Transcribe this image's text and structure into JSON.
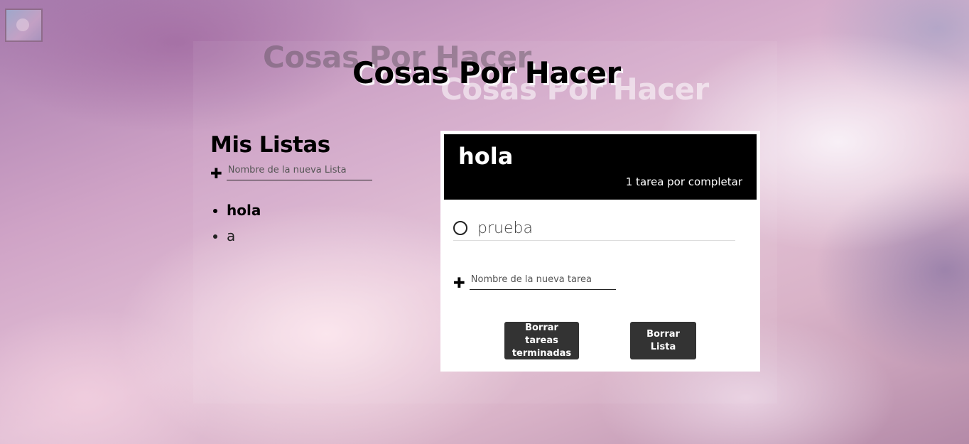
{
  "app": {
    "title": "Cosas Por Hacer"
  },
  "sidebar": {
    "heading": "Mis Listas",
    "add_icon": "plus-icon",
    "new_list_placeholder": "Nombre de la nueva Lista",
    "items": [
      {
        "label": "hola",
        "active": true
      },
      {
        "label": "a",
        "active": false
      }
    ]
  },
  "todo": {
    "list_title": "hola",
    "remaining_text": "1 tarea por completar",
    "tasks": [
      {
        "label": "prueba",
        "done": false
      }
    ],
    "add_icon": "plus-icon",
    "new_task_placeholder": "Nombre de la nueva tarea",
    "clear_button_label": "Borrar tareas terminadas",
    "delete_button_label": "Borrar Lista"
  },
  "colors": {
    "header_bg": "#000000",
    "button_bg": "#333333",
    "card_bg": "#ffffff"
  }
}
